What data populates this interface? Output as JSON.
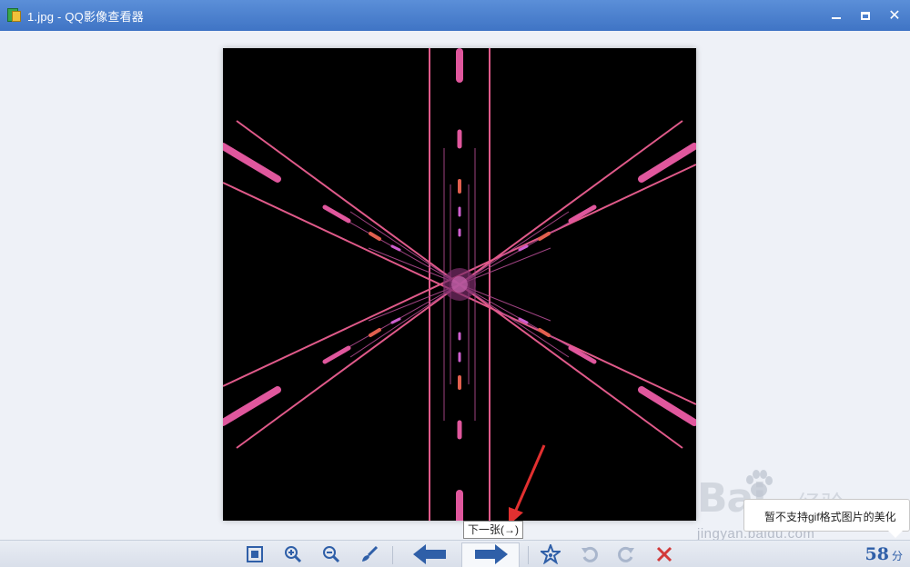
{
  "window": {
    "title": "1.jpg - QQ影像查看器",
    "controls": [
      "minimize",
      "maximize",
      "close"
    ]
  },
  "tooltip": {
    "text": "下一张(→)"
  },
  "balloon": {
    "text": "暂不支持gif格式图片的美化"
  },
  "watermark": {
    "logo": "Bai",
    "logo_cn": "经验",
    "url": "jingyan.baidu.com"
  },
  "toolbar": {
    "buttons": [
      {
        "name": "fit-window-icon",
        "enabled": true
      },
      {
        "name": "zoom-in-icon",
        "enabled": true
      },
      {
        "name": "zoom-out-icon",
        "enabled": true
      },
      {
        "name": "brush-icon",
        "enabled": true
      },
      {
        "name": "previous-arrow-icon",
        "enabled": true
      },
      {
        "name": "next-arrow-icon",
        "enabled": true
      },
      {
        "name": "star-effect-icon",
        "enabled": true
      },
      {
        "name": "rotate-left-icon",
        "enabled": false
      },
      {
        "name": "rotate-right-icon",
        "enabled": false
      },
      {
        "name": "delete-icon",
        "enabled": true
      }
    ],
    "count_value": "58",
    "count_unit": "分"
  },
  "colors": {
    "titlebar": "#4a80cf",
    "toolbar_icon": "#2f5fa8",
    "delete_icon": "#d23a3a",
    "disabled_icon": "#a9b6cc",
    "photo_line": "#e05a8a",
    "photo_dash": "#e0579d"
  }
}
